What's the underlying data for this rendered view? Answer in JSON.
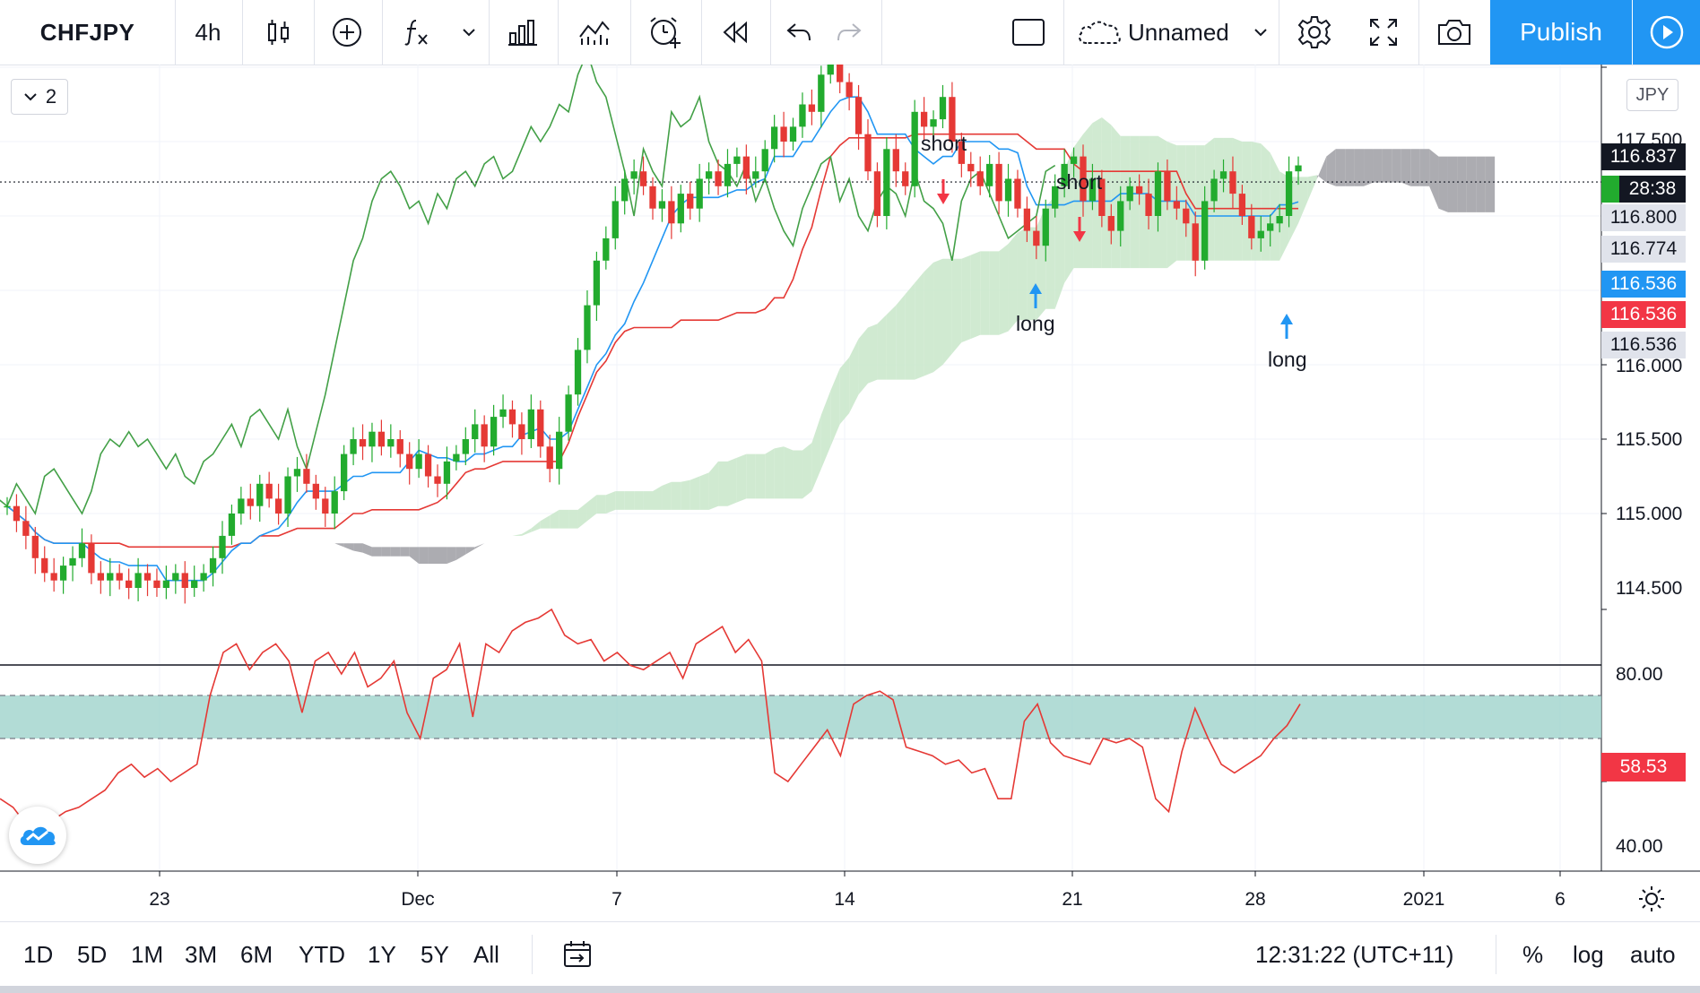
{
  "toolbar": {
    "symbol": "CHFJPY",
    "interval": "4h",
    "layout_name": "Unnamed",
    "publish_label": "Publish"
  },
  "legend_toggle": {
    "count": "2"
  },
  "currency": "JPY",
  "price_axis": {
    "labels": [
      "117.500",
      "116.000",
      "115.500",
      "115.000",
      "114.500"
    ],
    "tags": [
      {
        "label": "116.837",
        "bg": "#131722",
        "fg": "#ffffff"
      },
      {
        "label": "28:38",
        "bg": "#131722",
        "fg": "#ffffff"
      },
      {
        "label": "116.800",
        "bg": "#e0e3eb",
        "fg": "#131722"
      },
      {
        "label": "116.774",
        "bg": "#e0e3eb",
        "fg": "#131722"
      },
      {
        "label": "116.536",
        "bg": "#2196f3",
        "fg": "#ffffff"
      },
      {
        "label": "116.536",
        "bg": "#f23645",
        "fg": "#ffffff"
      },
      {
        "label": "116.536",
        "bg": "#e0e3eb",
        "fg": "#131722"
      }
    ]
  },
  "rsi_axis": {
    "labels": [
      "80.00",
      "40.00"
    ],
    "current": "58.53"
  },
  "time_axis": {
    "labels": [
      "23",
      "Dec",
      "7",
      "14",
      "21",
      "28",
      "2021",
      "6"
    ]
  },
  "annotations": [
    "short",
    "short",
    "long",
    "long"
  ],
  "bottom": {
    "ranges": [
      "1D",
      "5D",
      "1M",
      "3M",
      "6M",
      "YTD",
      "1Y",
      "5Y",
      "All"
    ],
    "clock": "12:31:22 (UTC+11)",
    "percent": "%",
    "log": "log",
    "auto": "auto"
  },
  "colors": {
    "up": "#26a69a",
    "candle_up": "#22ab2e",
    "candle_down": "#e53935",
    "tenkan": "#2196f3",
    "kijun": "#e53935",
    "chikou": "#43a047",
    "kumo_bull": "#c8e6c9",
    "kumo_bear": "#9e9ea3",
    "rsi_line": "#e53935",
    "rsi_band": "#9fd3cc",
    "accent": "#2196f3"
  },
  "chart_data": {
    "type": "candlestick",
    "symbol": "CHFJPY",
    "interval": "4h",
    "ylim": [
      114.1,
      117.6
    ],
    "rsi_ylim": [
      30,
      82
    ],
    "current_price": 116.837,
    "close_series": [
      114.55,
      114.45,
      114.35,
      114.2,
      114.1,
      114.05,
      114.15,
      114.2,
      114.3,
      114.1,
      114.05,
      114.1,
      114.05,
      114.0,
      114.1,
      114.05,
      114.0,
      114.05,
      114.1,
      114.0,
      114.05,
      114.1,
      114.2,
      114.35,
      114.5,
      114.6,
      114.55,
      114.7,
      114.6,
      114.5,
      114.75,
      114.8,
      114.7,
      114.6,
      114.5,
      114.65,
      114.9,
      115.0,
      114.95,
      115.05,
      114.95,
      115.0,
      114.9,
      114.8,
      114.9,
      114.75,
      114.7,
      114.85,
      114.9,
      115.0,
      115.1,
      114.95,
      115.15,
      115.2,
      115.1,
      115.0,
      115.2,
      114.95,
      114.8,
      115.05,
      115.3,
      115.6,
      115.9,
      116.2,
      116.35,
      116.6,
      116.75,
      116.8,
      116.7,
      116.55,
      116.6,
      116.45,
      116.65,
      116.55,
      116.75,
      116.8,
      116.7,
      116.85,
      116.9,
      116.75,
      116.8,
      116.95,
      117.1,
      117.0,
      117.1,
      117.25,
      117.2,
      117.45,
      117.6,
      117.4,
      117.3,
      117.05,
      116.8,
      116.5,
      116.95,
      116.8,
      116.7,
      117.2,
      117.1,
      117.15,
      117.3,
      117.0,
      116.85,
      116.8,
      116.7,
      116.85,
      116.6,
      116.75,
      116.55,
      116.4,
      116.3,
      116.55,
      116.7,
      116.85,
      116.9,
      116.6,
      116.75,
      116.5,
      116.4,
      116.6,
      116.7,
      116.65,
      116.5,
      116.8,
      116.6,
      116.55,
      116.45,
      116.2,
      116.6,
      116.75,
      116.8,
      116.65,
      116.5,
      116.35,
      116.4,
      116.45,
      116.5,
      116.8,
      116.84
    ],
    "rsi_series": [
      36,
      34,
      30,
      28,
      31,
      33,
      34,
      36,
      38,
      42,
      44,
      41,
      43,
      40,
      42,
      44,
      60,
      70,
      72,
      66,
      70,
      72,
      68,
      56,
      68,
      70,
      65,
      70,
      62,
      64,
      68,
      56,
      50,
      64,
      66,
      72,
      55,
      72,
      70,
      75,
      77,
      78,
      80,
      74,
      72,
      73,
      68,
      70,
      67,
      66,
      68,
      70,
      64,
      72,
      74,
      76,
      70,
      73,
      68,
      42,
      40,
      44,
      48,
      52,
      46,
      58,
      60,
      61,
      59,
      48,
      47,
      46,
      44,
      45,
      42,
      43,
      36,
      36,
      54,
      58,
      49,
      46,
      45,
      44,
      50,
      49,
      50,
      48,
      36,
      33,
      47,
      57,
      50,
      44,
      42,
      44,
      46,
      50,
      53,
      58
    ],
    "rsi_levels": [
      60,
      50
    ]
  }
}
